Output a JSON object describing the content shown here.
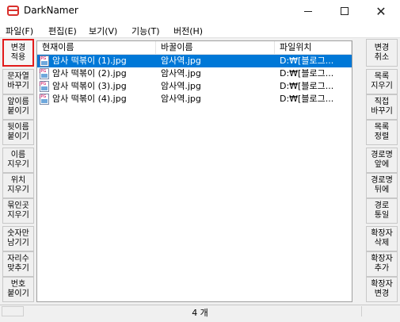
{
  "window": {
    "title": "DarkNamer"
  },
  "menu": [
    "파일(F)",
    "편집(E)",
    "보기(V)",
    "기능(T)",
    "버전(H)"
  ],
  "left_buttons": [
    {
      "label": "변경\n적용",
      "active": true
    },
    {
      "label": "문자열\n바꾸기"
    },
    {
      "label": "앞이름\n붙이기"
    },
    {
      "label": "뒷이름\n붙이기"
    },
    {
      "label": "이름\n지우기"
    },
    {
      "label": "위치\n지우기"
    },
    {
      "label": "묶인곳\n지우기"
    },
    {
      "label": "숫자만\n남기기"
    },
    {
      "label": "자리수\n맞추기"
    },
    {
      "label": "번호\n붙이기"
    }
  ],
  "right_buttons": [
    {
      "label": "변경\n취소"
    },
    {
      "label": "목록\n지우기"
    },
    {
      "label": "직접\n바꾸기"
    },
    {
      "label": "목록\n정렬"
    },
    {
      "label": "경로명\n앞에"
    },
    {
      "label": "경로명\n뒤에"
    },
    {
      "label": "경로\n통일"
    },
    {
      "label": "확장자\n삭제"
    },
    {
      "label": "확장자\n추가"
    },
    {
      "label": "확장자\n변경"
    }
  ],
  "columns": [
    "현재이름",
    "바꿀이름",
    "파일위치"
  ],
  "rows": [
    {
      "current": "암사 떡볶이 (1).jpg",
      "new": "암사역.jpg",
      "location": "D:₩[블로그...",
      "selected": true
    },
    {
      "current": "암사 떡볶이 (2).jpg",
      "new": "암사역.jpg",
      "location": "D:₩[블로그..."
    },
    {
      "current": "암사 떡볶이 (3).jpg",
      "new": "암사역.jpg",
      "location": "D:₩[블로그..."
    },
    {
      "current": "암사 떡볶이 (4).jpg",
      "new": "암사역.jpg",
      "location": "D:₩[블로그..."
    }
  ],
  "status": {
    "count": "4 개"
  }
}
